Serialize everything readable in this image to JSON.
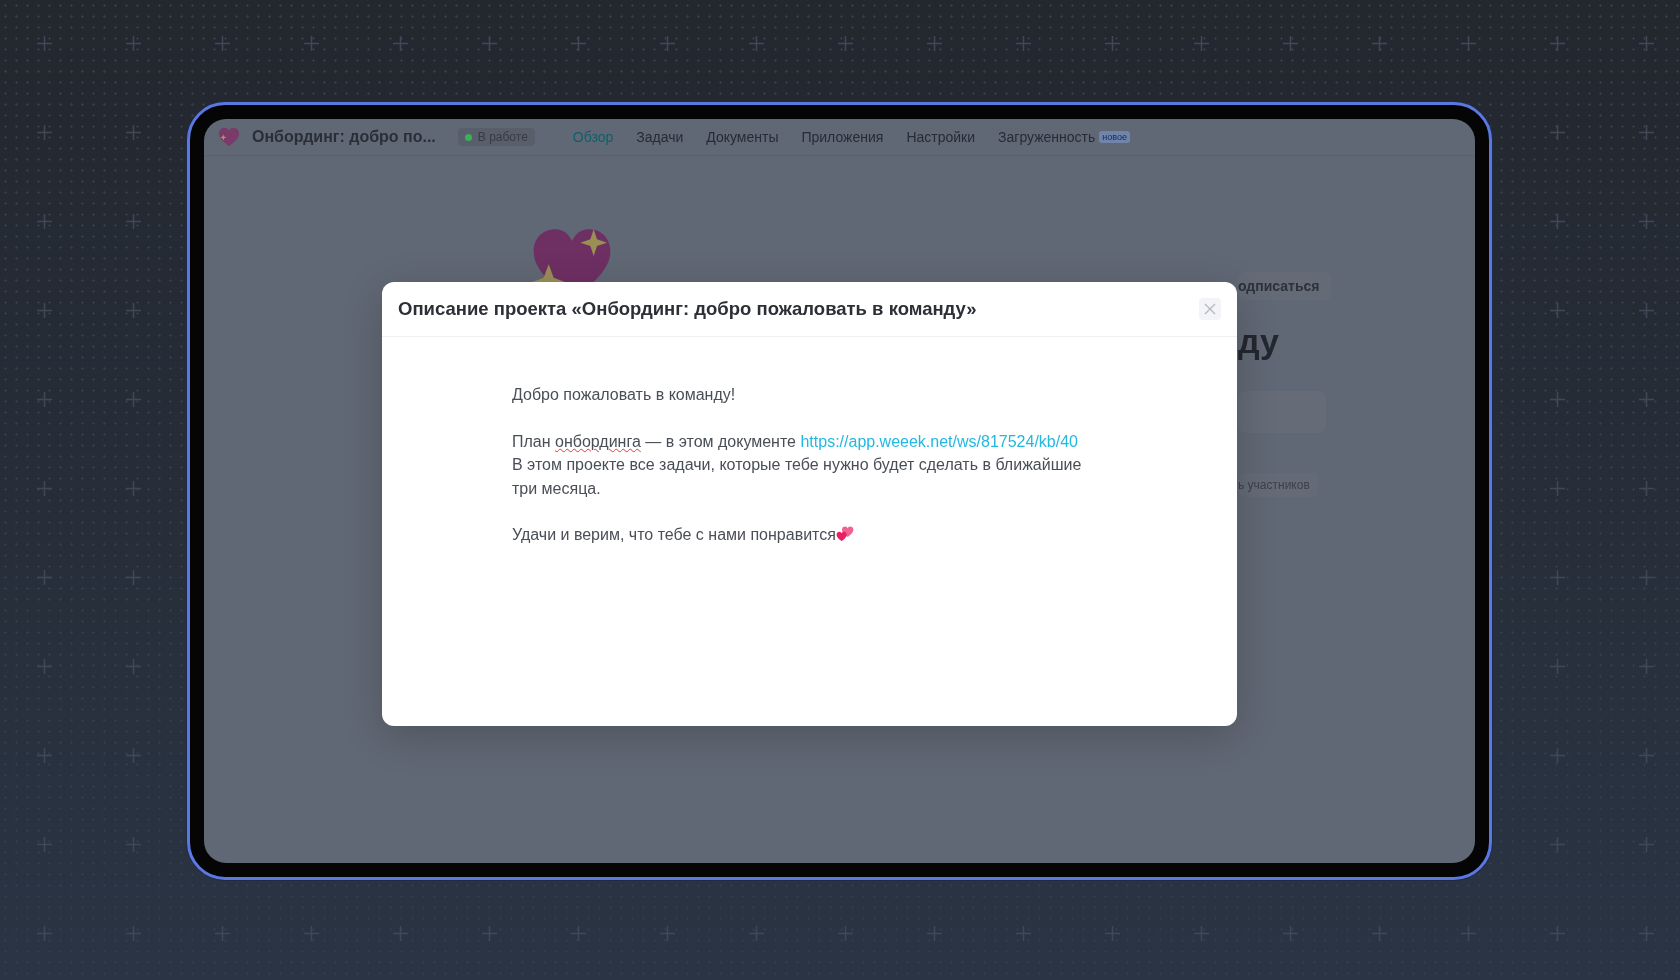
{
  "app": {
    "project_title": "Онбординг: добро по...",
    "status": {
      "label": "В работе",
      "color": "#3fae5a"
    },
    "tabs": [
      {
        "label": "Обзор",
        "selected": true
      },
      {
        "label": "Задачи",
        "selected": false
      },
      {
        "label": "Документы",
        "selected": false
      },
      {
        "label": "Приложения",
        "selected": false
      },
      {
        "label": "Настройки",
        "selected": false
      },
      {
        "label": "Загруженность",
        "selected": false,
        "badge": "новое"
      }
    ],
    "background_fragments": {
      "subscribe_button": "одписаться",
      "heading": "ду",
      "members_link": "ь участников"
    }
  },
  "modal": {
    "title": "Описание проекта «Онбординг: добро пожаловать в команду»",
    "paragraphs": [
      {
        "segments": [
          {
            "kind": "text",
            "text": "Добро пожаловать в команду!"
          }
        ]
      },
      {
        "segments": [
          {
            "kind": "text",
            "text": "План "
          },
          {
            "kind": "misspelled",
            "text": "онбординга"
          },
          {
            "kind": "text",
            "text": " — в этом документе "
          },
          {
            "kind": "link",
            "text": "https://app.weeek.net/ws/817524/kb/40"
          },
          {
            "kind": "break"
          },
          {
            "kind": "text",
            "text": "В этом проекте все задачи, которые тебе нужно будет сделать в ближайшие три месяца."
          }
        ]
      },
      {
        "segments": [
          {
            "kind": "text",
            "text": "Удачи и верим, что тебе с нами понравится"
          },
          {
            "kind": "hearts"
          }
        ]
      }
    ]
  }
}
